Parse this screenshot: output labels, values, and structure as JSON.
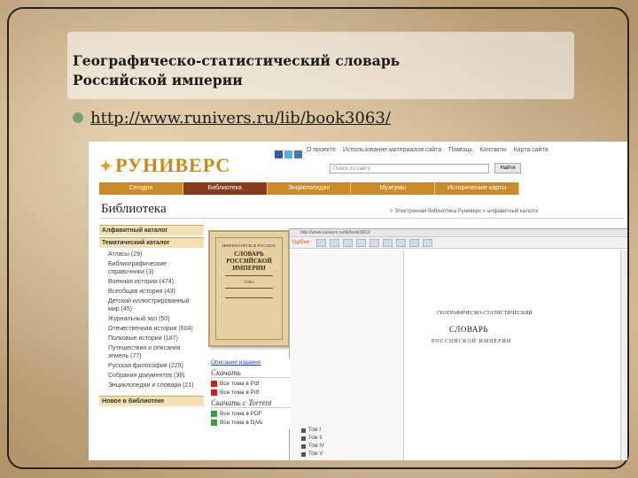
{
  "slide": {
    "title": "Географическо-статистический словарь\nРоссийской империи",
    "link": "http://www.runivers.ru/lib/book3063/"
  },
  "site": {
    "logo": "РУНИВЕРС",
    "top_links": [
      "О проекте",
      "Использование материалов сайта",
      "Помощь",
      "Контакты",
      "Карта сайта"
    ],
    "search_placeholder": "Поиск по сайту",
    "search_button": "Найти",
    "nav": [
      "Сегодня",
      "Библиотека",
      "Энциклопедия",
      "Музеумы",
      "Исторические карты"
    ],
    "nav_active": "Библиотека",
    "heading": "Библиотека",
    "breadcrumb": "» Электронная библиотека Руниверс » алфавитный каталог",
    "catalog": {
      "head1": "Алфавитный каталог",
      "head2": "Тематический каталог",
      "items": [
        "Атласы (29)",
        "Библиографические справочники (3)",
        "Военная история (474)",
        "Всеобщая история (43)",
        "Детский иллюстрированный мир (45)",
        "Журнальный зал (50)",
        "Отечественная история (604)",
        "Полковые истории (187)",
        "Путешествия и описания земель (77)",
        "Русская философия (229)",
        "Собрания документов (36)",
        "Энциклопедии и словари (21)"
      ],
      "footer": "Новое в библиотеке"
    },
    "cover": {
      "line1": "ИМПЕРАТОРСКОЕ РУССКОЕ",
      "title": "СЛОВАРЬ РОССИЙСКОЙ ИМПЕРИИ",
      "line3": "ТОМ I"
    },
    "downloads": {
      "head": "Описание издания",
      "title_download": "Скачать",
      "items": [
        "Все тома в Pdf",
        "Все тома в Pdf"
      ],
      "title_torrent": "Скачать с Torrent",
      "torrent_items": [
        "Все тома в PDF",
        "Все тома в DjVu"
      ]
    },
    "viewer": {
      "address": "http://www.runivers.ru/lib/book3063/",
      "toolbar_label": "Удобно",
      "page_line1": "ГЕОГРАФИЧЕСКО-СТАТИСТИЧЕСКИЙ",
      "page_title": "СЛОВАРЬ",
      "page_line3": "РОССИЙСКОЙ ИМПЕРИИ",
      "tomes": [
        "Том I",
        "Том II",
        "Том IV",
        "Том V"
      ]
    }
  }
}
